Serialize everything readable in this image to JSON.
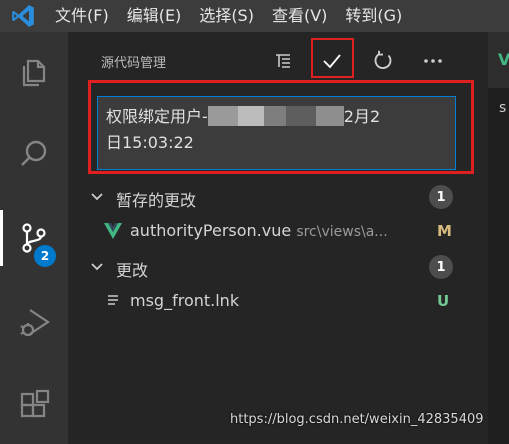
{
  "menubar": {
    "app_icon": "vscode-logo-icon",
    "items": [
      "文件(F)",
      "编辑(E)",
      "选择(S)",
      "查看(V)",
      "转到(G)"
    ]
  },
  "activity_bar": {
    "items": [
      {
        "icon": "files-icon"
      },
      {
        "icon": "search-icon"
      },
      {
        "icon": "source-control-icon",
        "badge": "2",
        "active": true
      },
      {
        "icon": "run-debug-icon"
      },
      {
        "icon": "extensions-icon"
      }
    ]
  },
  "source_control": {
    "title": "源代码管理",
    "toolbar": {
      "view_tree_icon": "tree-view-icon",
      "commit_icon": "check-icon",
      "refresh_icon": "refresh-icon",
      "more_icon": "ellipsis-icon"
    },
    "commit_message": {
      "line1_start": "权限绑定用户-",
      "line1_end": "2月2",
      "line2": "日15:03:22"
    },
    "staged": {
      "label": "暂存的更改",
      "count": "1",
      "files": [
        {
          "name": "authorityPerson.vue",
          "path": "src\\views\\a...",
          "status": "M",
          "icon": "vue-file-icon",
          "status_color": "#d7ba7d"
        }
      ]
    },
    "changes": {
      "label": "更改",
      "count": "1",
      "files": [
        {
          "name": "msg_front.lnk",
          "status": "U",
          "icon": "file-lines-icon",
          "status_color": "#73c991"
        }
      ]
    }
  },
  "editor_edge": {
    "tab_glyph": "V",
    "text_glyph": "s"
  },
  "watermark": "https://blog.csdn.net/weixin_42835409",
  "colors": {
    "accent": "#007acc",
    "highlight": "#e02020",
    "vue_green": "#41b883"
  }
}
